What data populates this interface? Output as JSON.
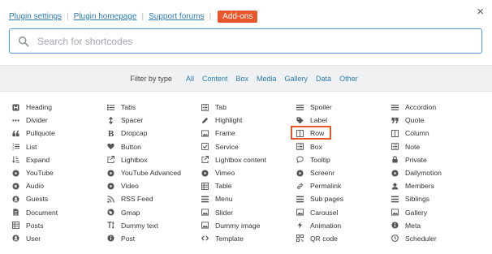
{
  "header": {
    "links": [
      "Plugin settings",
      "Plugin homepage",
      "Support forums"
    ],
    "addons_label": "Add-ons",
    "close_glyph": "×",
    "accent_color": "#e9562b",
    "link_color": "#2a7db8"
  },
  "search": {
    "placeholder": "Search for shortcodes",
    "value": ""
  },
  "filter": {
    "label": "Filter by type",
    "types": [
      "All",
      "Content",
      "Box",
      "Media",
      "Gallery",
      "Data",
      "Other"
    ]
  },
  "shortcodes": [
    [
      "Heading",
      "Tabs",
      "Tab",
      "Spoiler",
      "Accordion"
    ],
    [
      "Divider",
      "Spacer",
      "Highlight",
      "Label",
      "Quote"
    ],
    [
      "Pullquote",
      "Dropcap",
      "Frame",
      "Row",
      "Column"
    ],
    [
      "List",
      "Button",
      "Service",
      "Box",
      "Note"
    ],
    [
      "Expand",
      "Lightbox",
      "Lightbox content",
      "Tooltip",
      "Private"
    ],
    [
      "YouTube",
      "YouTube Advanced",
      "Vimeo",
      "Screenr",
      "Dailymotion"
    ],
    [
      "Audio",
      "Video",
      "Table",
      "Permalink",
      "Members"
    ],
    [
      "Guests",
      "RSS Feed",
      "Menu",
      "Sub pages",
      "Siblings"
    ],
    [
      "Document",
      "Gmap",
      "Slider",
      "Carousel",
      "Gallery"
    ],
    [
      "Posts",
      "Dummy text",
      "Dummy image",
      "Animation",
      "Meta"
    ],
    [
      "User",
      "Post",
      "Template",
      "QR code",
      "Scheduler"
    ]
  ],
  "icons": [
    [
      "h-square-icon",
      "list-ul-icon",
      "list-alt-icon",
      "list-icon",
      "list-icon"
    ],
    [
      "ellipsis-icon",
      "arrows-v-icon",
      "pencil-icon",
      "tag-icon",
      "quote-right-icon"
    ],
    [
      "quote-left-icon",
      "bold-icon",
      "picture-icon",
      "columns-icon",
      "columns-icon"
    ],
    [
      "list-ol-icon",
      "heart-icon",
      "check-square-icon",
      "list-alt-icon",
      "list-alt-icon"
    ],
    [
      "sort-amount-icon",
      "external-link-icon",
      "external-link-icon",
      "comment-icon",
      "lock-icon"
    ],
    [
      "youtube-icon",
      "youtube-icon",
      "youtube-icon",
      "youtube-icon",
      "youtube-icon"
    ],
    [
      "volume-icon",
      "film-icon",
      "th-list-icon",
      "link-icon",
      "users-icon"
    ],
    [
      "user-icon",
      "rss-icon",
      "bars-icon",
      "bars-icon",
      "bars-icon"
    ],
    [
      "file-icon",
      "globe-icon",
      "picture-icon",
      "picture-icon",
      "picture-icon"
    ],
    [
      "th-list-icon",
      "text-height-icon",
      "picture-icon",
      "bolt-icon",
      "info-icon"
    ],
    [
      "user-icon",
      "info-icon",
      "code-icon",
      "qrcode-icon",
      "clock-icon"
    ]
  ],
  "active_item": "Row",
  "icon_color": "#555555"
}
